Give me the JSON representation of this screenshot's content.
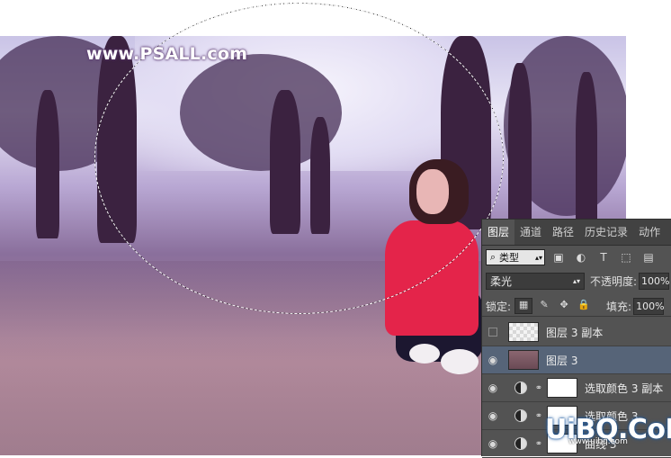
{
  "watermark": {
    "text": "www.PSALL.com"
  },
  "panel": {
    "tabs": [
      "图层",
      "通道",
      "路径",
      "历史记录",
      "动作"
    ],
    "filter": {
      "icon": "search-icon",
      "value": "类型"
    },
    "blend_mode": "柔光",
    "opacity_label": "不透明度:",
    "opacity_value": "100%",
    "lock_label": "锁定:",
    "fill_label": "填充:",
    "fill_value": "100%",
    "layers": [
      {
        "name": "图层 3 副本",
        "visible": false,
        "thumb": "checker",
        "selected": false
      },
      {
        "name": "图层 3",
        "visible": true,
        "thumb": "brown",
        "selected": true
      },
      {
        "name": "选取颜色 3 副本",
        "visible": true,
        "thumb": "white",
        "adjustment": true
      },
      {
        "name": "选取颜色 3",
        "visible": true,
        "thumb": "white",
        "adjustment": true
      },
      {
        "name": "曲线 3",
        "visible": true,
        "thumb": "white",
        "adjustment": true
      }
    ]
  },
  "logo": {
    "text": "UiBQ.CoM",
    "sub": "www.uibq.com"
  },
  "colors": {
    "panel_bg": "#535353",
    "selected_row": "#566478",
    "accent_red": "#e4244a"
  }
}
